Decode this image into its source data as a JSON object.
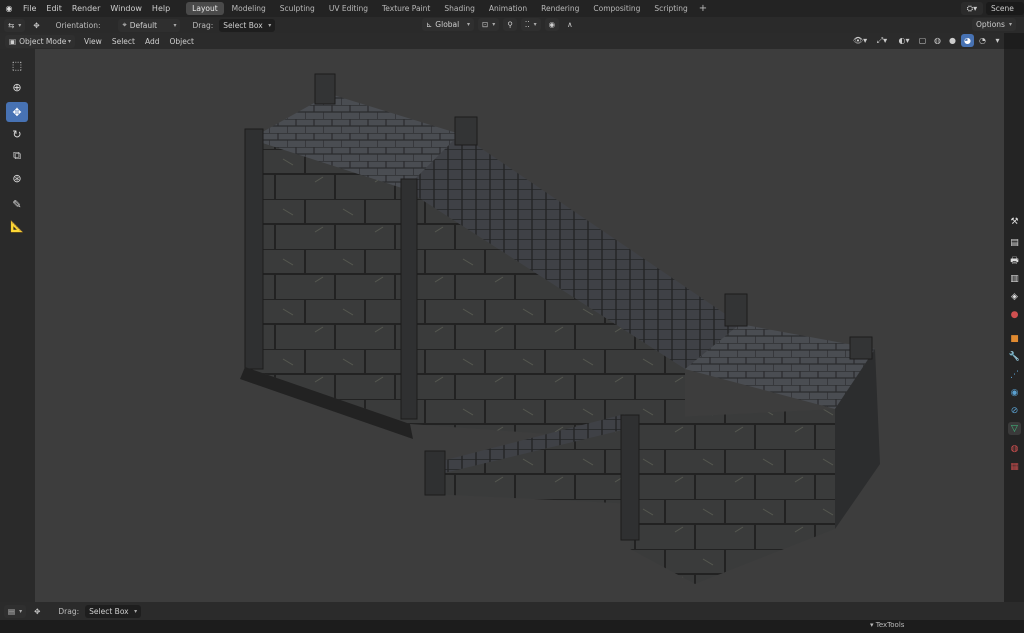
{
  "topbar": {
    "menus": [
      "File",
      "Edit",
      "Render",
      "Window",
      "Help"
    ],
    "workspaces": [
      "Layout",
      "Modeling",
      "Sculpting",
      "UV Editing",
      "Texture Paint",
      "Shading",
      "Animation",
      "Rendering",
      "Compositing",
      "Scripting"
    ],
    "active_workspace": "Layout",
    "scene_label": "Scene"
  },
  "toolheader": {
    "orientation_label": "Orientation:",
    "orientation_value": "Default",
    "drag_label": "Drag:",
    "drag_value": "Select Box",
    "transform_orientation": "Global",
    "options_label": "Options"
  },
  "viewport_header": {
    "mode": "Object Mode",
    "menus": [
      "View",
      "Select",
      "Add",
      "Object"
    ]
  },
  "bottom_header": {
    "drag_label": "Drag:",
    "drag_value": "Select Box"
  },
  "status": {
    "panel_label": "TexTools"
  },
  "colors": {
    "accent": "#4772b3",
    "viewport_bg": "#3d3d3d",
    "stone": "#3a3a3c"
  },
  "icons": {
    "tools": [
      "select-box-icon",
      "cursor-icon",
      "move-icon",
      "rotate-icon",
      "scale-icon",
      "transform-icon",
      "annotate-icon",
      "measure-icon"
    ],
    "properties": [
      "tool-icon",
      "render-icon",
      "output-icon",
      "view-layer-icon",
      "scene-icon",
      "world-icon",
      "object-icon",
      "modifier-icon",
      "particles-icon",
      "physics-icon",
      "constraints-icon",
      "data-icon",
      "material-icon"
    ]
  }
}
